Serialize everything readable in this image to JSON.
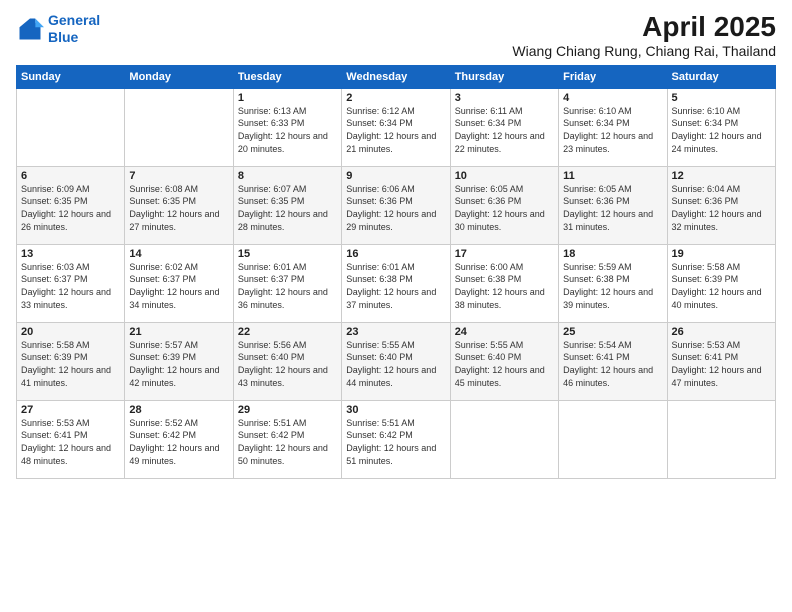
{
  "logo": {
    "line1": "General",
    "line2": "Blue"
  },
  "title": "April 2025",
  "subtitle": "Wiang Chiang Rung, Chiang Rai, Thailand",
  "headers": [
    "Sunday",
    "Monday",
    "Tuesday",
    "Wednesday",
    "Thursday",
    "Friday",
    "Saturday"
  ],
  "weeks": [
    [
      {
        "day": "",
        "sunrise": "",
        "sunset": "",
        "daylight": ""
      },
      {
        "day": "",
        "sunrise": "",
        "sunset": "",
        "daylight": ""
      },
      {
        "day": "1",
        "sunrise": "Sunrise: 6:13 AM",
        "sunset": "Sunset: 6:33 PM",
        "daylight": "Daylight: 12 hours and 20 minutes."
      },
      {
        "day": "2",
        "sunrise": "Sunrise: 6:12 AM",
        "sunset": "Sunset: 6:34 PM",
        "daylight": "Daylight: 12 hours and 21 minutes."
      },
      {
        "day": "3",
        "sunrise": "Sunrise: 6:11 AM",
        "sunset": "Sunset: 6:34 PM",
        "daylight": "Daylight: 12 hours and 22 minutes."
      },
      {
        "day": "4",
        "sunrise": "Sunrise: 6:10 AM",
        "sunset": "Sunset: 6:34 PM",
        "daylight": "Daylight: 12 hours and 23 minutes."
      },
      {
        "day": "5",
        "sunrise": "Sunrise: 6:10 AM",
        "sunset": "Sunset: 6:34 PM",
        "daylight": "Daylight: 12 hours and 24 minutes."
      }
    ],
    [
      {
        "day": "6",
        "sunrise": "Sunrise: 6:09 AM",
        "sunset": "Sunset: 6:35 PM",
        "daylight": "Daylight: 12 hours and 26 minutes."
      },
      {
        "day": "7",
        "sunrise": "Sunrise: 6:08 AM",
        "sunset": "Sunset: 6:35 PM",
        "daylight": "Daylight: 12 hours and 27 minutes."
      },
      {
        "day": "8",
        "sunrise": "Sunrise: 6:07 AM",
        "sunset": "Sunset: 6:35 PM",
        "daylight": "Daylight: 12 hours and 28 minutes."
      },
      {
        "day": "9",
        "sunrise": "Sunrise: 6:06 AM",
        "sunset": "Sunset: 6:36 PM",
        "daylight": "Daylight: 12 hours and 29 minutes."
      },
      {
        "day": "10",
        "sunrise": "Sunrise: 6:05 AM",
        "sunset": "Sunset: 6:36 PM",
        "daylight": "Daylight: 12 hours and 30 minutes."
      },
      {
        "day": "11",
        "sunrise": "Sunrise: 6:05 AM",
        "sunset": "Sunset: 6:36 PM",
        "daylight": "Daylight: 12 hours and 31 minutes."
      },
      {
        "day": "12",
        "sunrise": "Sunrise: 6:04 AM",
        "sunset": "Sunset: 6:36 PM",
        "daylight": "Daylight: 12 hours and 32 minutes."
      }
    ],
    [
      {
        "day": "13",
        "sunrise": "Sunrise: 6:03 AM",
        "sunset": "Sunset: 6:37 PM",
        "daylight": "Daylight: 12 hours and 33 minutes."
      },
      {
        "day": "14",
        "sunrise": "Sunrise: 6:02 AM",
        "sunset": "Sunset: 6:37 PM",
        "daylight": "Daylight: 12 hours and 34 minutes."
      },
      {
        "day": "15",
        "sunrise": "Sunrise: 6:01 AM",
        "sunset": "Sunset: 6:37 PM",
        "daylight": "Daylight: 12 hours and 36 minutes."
      },
      {
        "day": "16",
        "sunrise": "Sunrise: 6:01 AM",
        "sunset": "Sunset: 6:38 PM",
        "daylight": "Daylight: 12 hours and 37 minutes."
      },
      {
        "day": "17",
        "sunrise": "Sunrise: 6:00 AM",
        "sunset": "Sunset: 6:38 PM",
        "daylight": "Daylight: 12 hours and 38 minutes."
      },
      {
        "day": "18",
        "sunrise": "Sunrise: 5:59 AM",
        "sunset": "Sunset: 6:38 PM",
        "daylight": "Daylight: 12 hours and 39 minutes."
      },
      {
        "day": "19",
        "sunrise": "Sunrise: 5:58 AM",
        "sunset": "Sunset: 6:39 PM",
        "daylight": "Daylight: 12 hours and 40 minutes."
      }
    ],
    [
      {
        "day": "20",
        "sunrise": "Sunrise: 5:58 AM",
        "sunset": "Sunset: 6:39 PM",
        "daylight": "Daylight: 12 hours and 41 minutes."
      },
      {
        "day": "21",
        "sunrise": "Sunrise: 5:57 AM",
        "sunset": "Sunset: 6:39 PM",
        "daylight": "Daylight: 12 hours and 42 minutes."
      },
      {
        "day": "22",
        "sunrise": "Sunrise: 5:56 AM",
        "sunset": "Sunset: 6:40 PM",
        "daylight": "Daylight: 12 hours and 43 minutes."
      },
      {
        "day": "23",
        "sunrise": "Sunrise: 5:55 AM",
        "sunset": "Sunset: 6:40 PM",
        "daylight": "Daylight: 12 hours and 44 minutes."
      },
      {
        "day": "24",
        "sunrise": "Sunrise: 5:55 AM",
        "sunset": "Sunset: 6:40 PM",
        "daylight": "Daylight: 12 hours and 45 minutes."
      },
      {
        "day": "25",
        "sunrise": "Sunrise: 5:54 AM",
        "sunset": "Sunset: 6:41 PM",
        "daylight": "Daylight: 12 hours and 46 minutes."
      },
      {
        "day": "26",
        "sunrise": "Sunrise: 5:53 AM",
        "sunset": "Sunset: 6:41 PM",
        "daylight": "Daylight: 12 hours and 47 minutes."
      }
    ],
    [
      {
        "day": "27",
        "sunrise": "Sunrise: 5:53 AM",
        "sunset": "Sunset: 6:41 PM",
        "daylight": "Daylight: 12 hours and 48 minutes."
      },
      {
        "day": "28",
        "sunrise": "Sunrise: 5:52 AM",
        "sunset": "Sunset: 6:42 PM",
        "daylight": "Daylight: 12 hours and 49 minutes."
      },
      {
        "day": "29",
        "sunrise": "Sunrise: 5:51 AM",
        "sunset": "Sunset: 6:42 PM",
        "daylight": "Daylight: 12 hours and 50 minutes."
      },
      {
        "day": "30",
        "sunrise": "Sunrise: 5:51 AM",
        "sunset": "Sunset: 6:42 PM",
        "daylight": "Daylight: 12 hours and 51 minutes."
      },
      {
        "day": "",
        "sunrise": "",
        "sunset": "",
        "daylight": ""
      },
      {
        "day": "",
        "sunrise": "",
        "sunset": "",
        "daylight": ""
      },
      {
        "day": "",
        "sunrise": "",
        "sunset": "",
        "daylight": ""
      }
    ]
  ]
}
